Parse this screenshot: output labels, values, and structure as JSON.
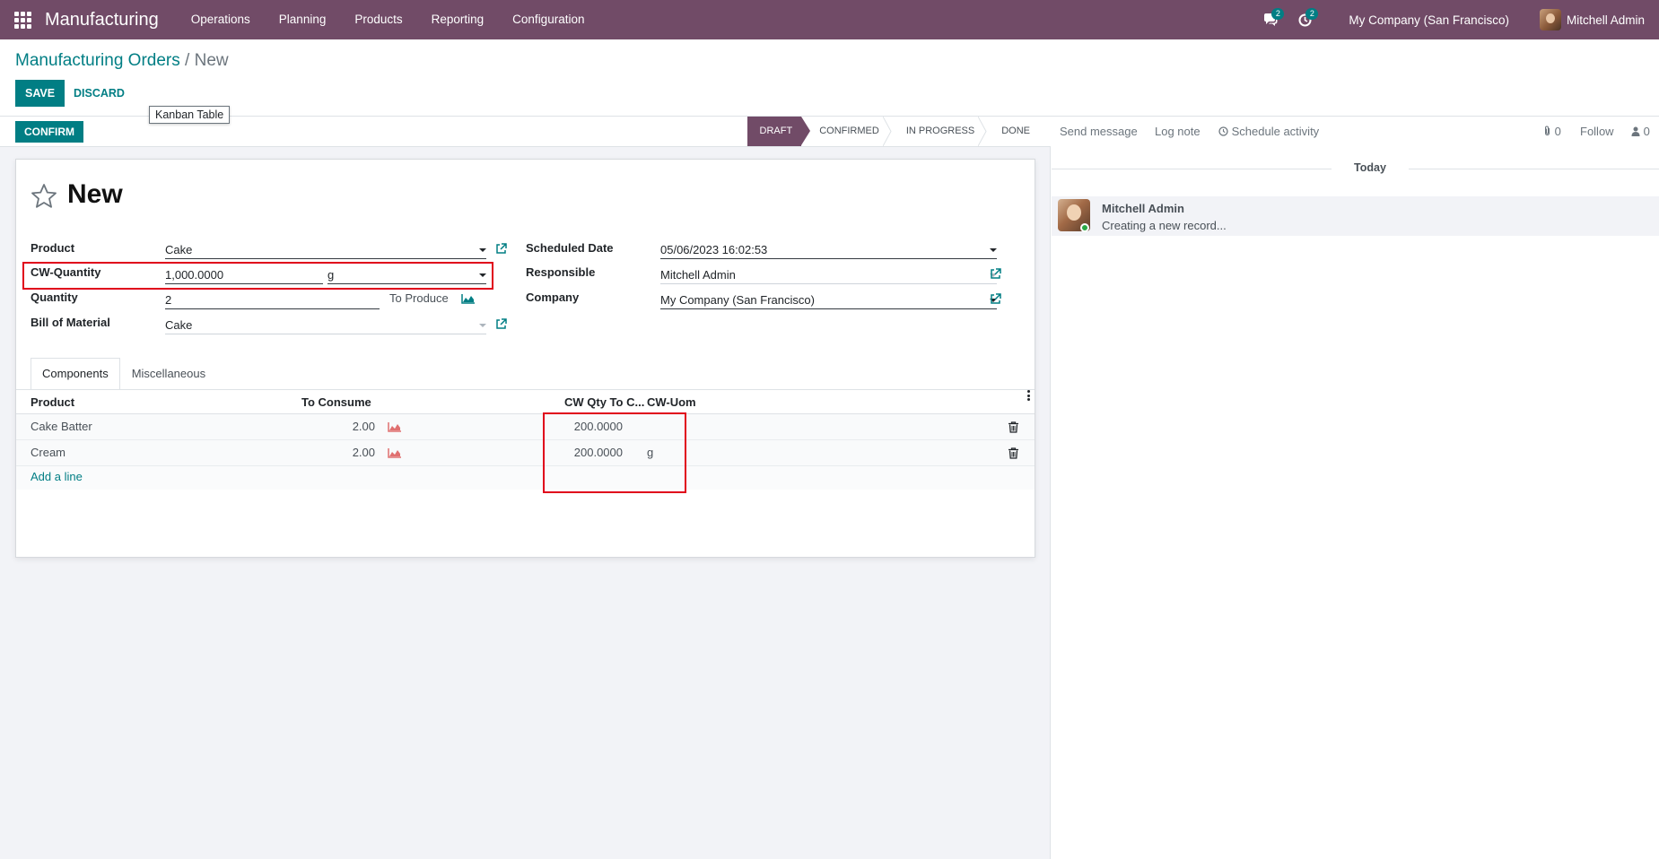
{
  "navbar": {
    "app_name": "Manufacturing",
    "menu": [
      "Operations",
      "Planning",
      "Products",
      "Reporting",
      "Configuration"
    ],
    "messages_count": "2",
    "activities_count": "2",
    "company": "My Company (San Francisco)",
    "user": "Mitchell Admin"
  },
  "breadcrumb": {
    "parent": "Manufacturing Orders",
    "separator": "/",
    "current": "New"
  },
  "buttons": {
    "save": "SAVE",
    "discard": "DISCARD",
    "confirm": "CONFIRM"
  },
  "tooltip": "Kanban Table",
  "statusbar": {
    "stages": [
      "DRAFT",
      "CONFIRMED",
      "IN PROGRESS",
      "DONE"
    ],
    "active": "DRAFT"
  },
  "record": {
    "title": "New",
    "product_label": "Product",
    "product": "Cake",
    "cw_quantity_label": "CW-Quantity",
    "cw_quantity": "1,000.0000",
    "cw_uom": "g",
    "quantity_label": "Quantity",
    "quantity": "2",
    "to_produce": "To Produce",
    "bom_label": "Bill of Material",
    "bom": "Cake",
    "scheduled_date_label": "Scheduled Date",
    "scheduled_date": "05/06/2023 16:02:53",
    "responsible_label": "Responsible",
    "responsible": "Mitchell Admin",
    "company_label": "Company",
    "company": "My Company (San Francisco)"
  },
  "tabs": [
    "Components",
    "Miscellaneous"
  ],
  "components": {
    "headers": {
      "product": "Product",
      "to_consume": "To Consume",
      "cw_qty": "CW Qty To C...",
      "cw_uom": "CW-Uom"
    },
    "rows": [
      {
        "product": "Cake Batter",
        "to_consume": "2.00",
        "cw_qty": "200.0000",
        "cw_uom": ""
      },
      {
        "product": "Cream",
        "to_consume": "2.00",
        "cw_qty": "200.0000",
        "cw_uom": "g"
      }
    ],
    "add_line": "Add a line"
  },
  "chatter": {
    "send_message": "Send message",
    "log_note": "Log note",
    "schedule_activity": "Schedule activity",
    "attachments": "0",
    "follow": "Follow",
    "followers": "0",
    "today": "Today",
    "message": {
      "author": "Mitchell Admin",
      "body": "Creating a new record..."
    }
  },
  "colors": {
    "brand": "#714b67",
    "primary": "#017e84",
    "highlight": "#e0001b"
  }
}
